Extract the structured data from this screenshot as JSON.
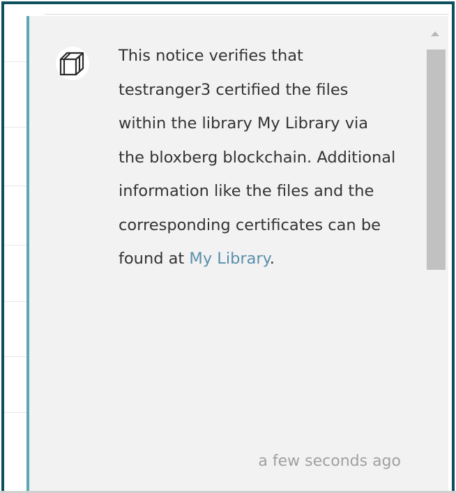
{
  "notice": {
    "avatar_icon": "cube-icon",
    "message_before_link": "This notice verifies that testranger3 certified the files within the library My Library via the bloxberg blockchain. Additional information like the files and the corresponding certificates can be found at ",
    "link_text": "My Library",
    "message_after_link": ".",
    "timestamp": "a few seconds ago"
  },
  "colors": {
    "frame_border": "#0d4f5c",
    "accent_border": "#5aa8b3",
    "link": "#5a8fad",
    "panel_background": "#f2f2f2",
    "timestamp_text": "#a0a0a0"
  }
}
